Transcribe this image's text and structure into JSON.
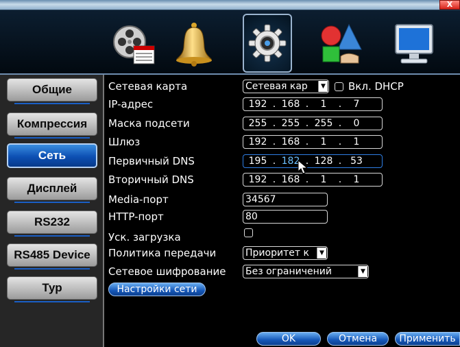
{
  "window": {
    "close_label": "X"
  },
  "top_tabs": [
    {
      "icon": "film-reel-icon"
    },
    {
      "icon": "bell-icon"
    },
    {
      "icon": "gear-icon"
    },
    {
      "icon": "shapes-icon"
    },
    {
      "icon": "monitor-icon"
    }
  ],
  "sidebar": {
    "items": [
      {
        "label": "Общие"
      },
      {
        "label": "Компрессия"
      },
      {
        "label": "Сеть"
      },
      {
        "label": "Дисплей"
      },
      {
        "label": "RS232"
      },
      {
        "label": "RS485 Device"
      },
      {
        "label": "Тур"
      }
    ],
    "active_index": 2
  },
  "network": {
    "network_card_label": "Сетевая карта",
    "network_card_value": "Сетевая кар",
    "dhcp_label": "Вкл. DHCP",
    "ip_label": "IP-адрес",
    "ip": [
      "192",
      "168",
      "1",
      "7"
    ],
    "mask_label": "Маска подсети",
    "mask": [
      "255",
      "255",
      "255",
      "0"
    ],
    "gateway_label": "Шлюз",
    "gateway": [
      "192",
      "168",
      "1",
      "1"
    ],
    "dns1_label": "Первичный DNS",
    "dns1": [
      "195",
      "182",
      "128",
      "53"
    ],
    "dns2_label": "Вторичный DNS",
    "dns2": [
      "192",
      "168",
      "1",
      "1"
    ],
    "media_port_label": "Media-порт",
    "media_port": "34567",
    "http_port_label": "HTTP-порт",
    "http_port": "80",
    "fast_boot_label": "Уск. загрузка",
    "transfer_policy_label": "Политика передачи",
    "transfer_policy_value": "Приоритет к",
    "encryption_label": "Сетевое шифрование",
    "encryption_value": "Без ограничений",
    "settings_button": "Настройки сети"
  },
  "footer": {
    "ok": "OK",
    "cancel": "Отмена",
    "apply": "Применить"
  },
  "colors": {
    "highlight_digit": "#6ec1ff",
    "active_field_border": "#2f7fe6"
  }
}
